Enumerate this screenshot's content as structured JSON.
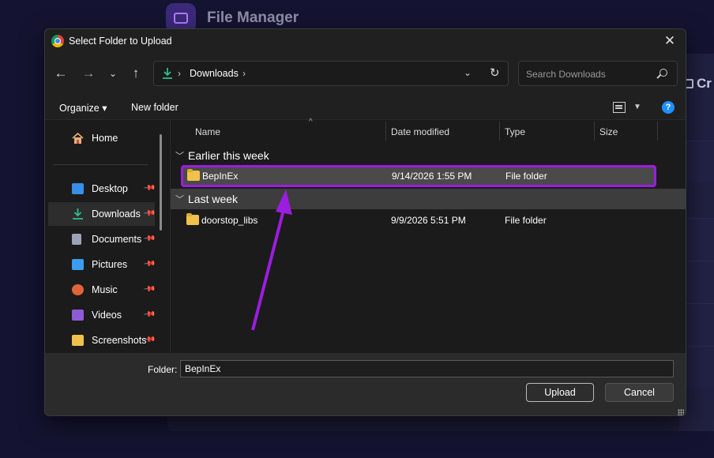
{
  "background_app": {
    "title": "File Manager",
    "create_label": "Cr"
  },
  "dialog": {
    "title": "Select Folder to Upload",
    "address": {
      "location": "Downloads",
      "search_placeholder": "Search Downloads"
    },
    "commands": {
      "organize": "Organize",
      "new_folder": "New folder"
    },
    "sidebar": {
      "home": "Home",
      "items": [
        {
          "label": "Desktop",
          "icon": "desktop-icon",
          "color": "#3a8ee6"
        },
        {
          "label": "Downloads",
          "icon": "download-icon",
          "color": "#2fbf8f"
        },
        {
          "label": "Documents",
          "icon": "document-icon",
          "color": "#9aa4b5"
        },
        {
          "label": "Pictures",
          "icon": "pictures-icon",
          "color": "#3b9cf0"
        },
        {
          "label": "Music",
          "icon": "music-icon",
          "color": "#e0643a"
        },
        {
          "label": "Videos",
          "icon": "videos-icon",
          "color": "#8e5bd6"
        },
        {
          "label": "Screenshots",
          "icon": "folder-icon",
          "color": "#f0c14b"
        }
      ]
    },
    "columns": [
      "Name",
      "Date modified",
      "Type",
      "Size"
    ],
    "groups": [
      {
        "label": "Earlier this week",
        "rows": [
          {
            "name": "BepInEx",
            "date": "9/14/2026 1:55 PM",
            "type": "File folder"
          }
        ]
      },
      {
        "label": "Last week",
        "rows": [
          {
            "name": "doorstop_libs",
            "date": "9/9/2026 5:51 PM",
            "type": "File folder"
          }
        ]
      }
    ],
    "footer": {
      "folder_label": "Folder:",
      "folder_value": "BepInEx",
      "upload": "Upload",
      "cancel": "Cancel"
    }
  },
  "colors": {
    "annotation_purple": "#9b1ddf",
    "dialog_bg": "#202020",
    "help_blue": "#1e90ff"
  }
}
